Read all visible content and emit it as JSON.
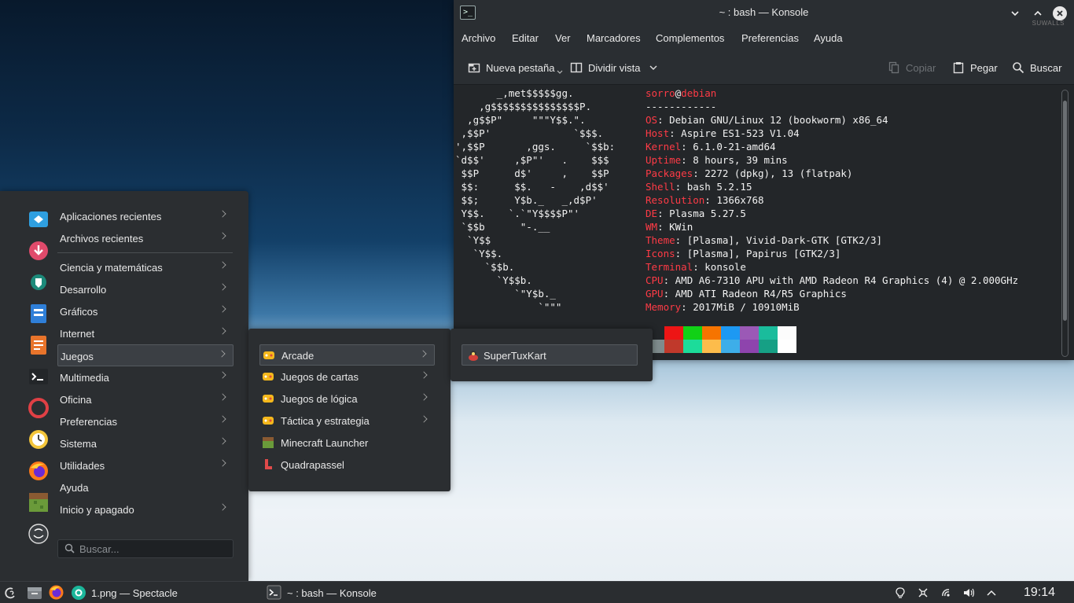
{
  "konsole": {
    "title": "~ : bash — Konsole",
    "watermark": "SUWALLS",
    "menus": [
      "Archivo",
      "Editar",
      "Ver",
      "Marcadores",
      "Complementos",
      "Preferencias",
      "Ayuda"
    ],
    "toolbar": {
      "new_tab": "Nueva pestaña",
      "split_view": "Dividir vista",
      "copy": "Copiar",
      "paste": "Pegar",
      "search": "Buscar"
    },
    "terminal": {
      "logo_lines": [
        "       _,met$$$$$gg.",
        "    ,g$$$$$$$$$$$$$$$P.",
        "  ,g$$P\"     \"\"\"Y$$.\".",
        " ,$$P'              `$$$.",
        "',$$P       ,ggs.     `$$b:",
        "`d$$'     ,$P\"'   .    $$$",
        " $$P      d$'     ,    $$P",
        " $$:      $$.   -    ,d$$'",
        " $$;      Y$b._   _,d$P'",
        " Y$$.    `.`\"Y$$$$P\"'",
        " `$$b      \"-.__",
        "  `Y$$",
        "   `Y$$.",
        "     `$$b.",
        "       `Y$$b.",
        "          `\"Y$b._",
        "              `\"\"\""
      ],
      "user": "sorro",
      "host": "debian",
      "separator": "------------",
      "info": [
        {
          "key": "OS",
          "value": "Debian GNU/Linux 12 (bookworm) x86_64"
        },
        {
          "key": "Host",
          "value": "Aspire ES1-523 V1.04"
        },
        {
          "key": "Kernel",
          "value": "6.1.0-21-amd64"
        },
        {
          "key": "Uptime",
          "value": "8 hours, 39 mins"
        },
        {
          "key": "Packages",
          "value": "2272 (dpkg), 13 (flatpak)"
        },
        {
          "key": "Shell",
          "value": "bash 5.2.15"
        },
        {
          "key": "Resolution",
          "value": "1366x768"
        },
        {
          "key": "DE",
          "value": "Plasma 5.27.5"
        },
        {
          "key": "WM",
          "value": "KWin"
        },
        {
          "key": "Theme",
          "value": "[Plasma], Vivid-Dark-GTK [GTK2/3]"
        },
        {
          "key": "Icons",
          "value": "[Plasma], Papirus [GTK2/3]"
        },
        {
          "key": "Terminal",
          "value": "konsole"
        },
        {
          "key": "CPU",
          "value": "AMD A6-7310 APU with AMD Radeon R4 Graphics (4) @ 2.000GHz"
        },
        {
          "key": "GPU",
          "value": "AMD ATI Radeon R4/R5 Graphics"
        },
        {
          "key": "Memory",
          "value": "2017MiB / 10910MiB"
        }
      ],
      "palette_top": [
        "#232629",
        "#ed1515",
        "#11d116",
        "#f67400",
        "#1d99f3",
        "#9b59b6",
        "#1abc9c",
        "#fcfcfc"
      ],
      "palette_bottom": [
        "#7f8c8d",
        "#c0392b",
        "#1cdc9a",
        "#fdbc4b",
        "#3daee9",
        "#8e44ad",
        "#16a085",
        "#ffffff"
      ]
    }
  },
  "launcher": {
    "categories": [
      {
        "label": "Aplicaciones recientes",
        "icon": "recent-apps-icon",
        "color": "#2f9fe0",
        "submenu": true
      },
      {
        "label": "Archivos recientes",
        "icon": "recent-files-icon",
        "color": "#e04a6b",
        "submenu": true
      },
      {
        "label": "Ciencia y matemáticas",
        "icon": "science-icon",
        "color": "#2b2e31",
        "submenu": true
      },
      {
        "label": "Desarrollo",
        "icon": "development-icon",
        "color": "#1c8a7a",
        "submenu": true
      },
      {
        "label": "Gráficos",
        "icon": "graphics-icon",
        "color": "#2f7fd8",
        "submenu": true
      },
      {
        "label": "Internet",
        "icon": "internet-icon",
        "color": "#e8742b",
        "submenu": true
      },
      {
        "label": "Juegos",
        "icon": "games-icon",
        "color": "#2b2e31",
        "submenu": true,
        "selected": true
      },
      {
        "label": "Multimedia",
        "icon": "multimedia-icon",
        "color": "#2b2e31",
        "submenu": true
      },
      {
        "label": "Oficina",
        "icon": "office-icon",
        "color": "#e04045",
        "submenu": true
      },
      {
        "label": "Preferencias",
        "icon": "preferences-icon",
        "color": "#2b2e31",
        "submenu": true
      },
      {
        "label": "Sistema",
        "icon": "system-icon",
        "color": "#6cb33f",
        "submenu": true
      },
      {
        "label": "Utilidades",
        "icon": "utilities-icon",
        "color": "#e8742b",
        "submenu": true
      },
      {
        "label": "Ayuda",
        "icon": "help-icon",
        "color": "#6a9a3a",
        "submenu": false
      },
      {
        "label": "Inicio y apagado",
        "icon": "power-icon",
        "color": "#2b2e31",
        "submenu": true
      }
    ],
    "search_placeholder": "Buscar...",
    "games_submenu": [
      {
        "label": "Arcade",
        "submenu": true,
        "selected": true
      },
      {
        "label": "Juegos de cartas",
        "submenu": true
      },
      {
        "label": "Juegos de lógica",
        "submenu": true
      },
      {
        "label": "Táctica y estrategia",
        "submenu": true
      },
      {
        "label": "Minecraft Launcher",
        "submenu": false
      },
      {
        "label": "Quadrapassel",
        "submenu": false
      }
    ],
    "arcade_submenu": [
      {
        "label": "SuperTuxKart"
      }
    ]
  },
  "taskbar": {
    "tasks": [
      {
        "label": "1.png — Spectacle"
      },
      {
        "label": "~ : bash — Konsole"
      }
    ],
    "clock": "19:14"
  }
}
